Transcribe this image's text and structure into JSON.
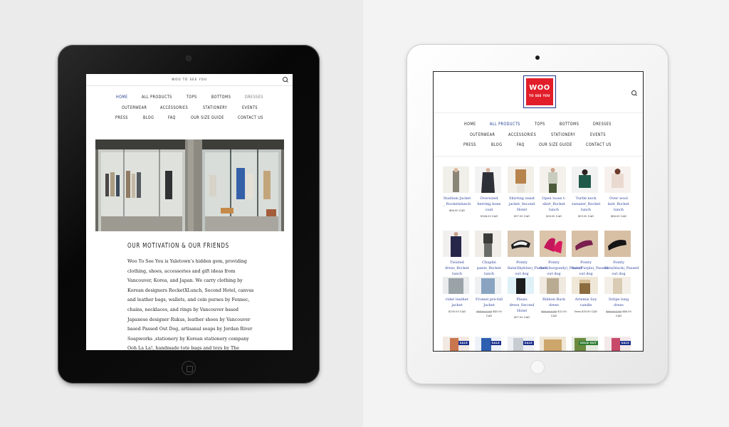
{
  "left_screen": {
    "brand": "WOO TO SEE YOU",
    "nav": [
      {
        "label": "HOME",
        "state": "active"
      },
      {
        "label": "ALL PRODUCTS",
        "state": ""
      },
      {
        "label": "TOPS",
        "state": ""
      },
      {
        "label": "BOTTOMS",
        "state": ""
      },
      {
        "label": "DRESSES",
        "state": "hover"
      },
      {
        "label": "OUTERWEAR",
        "state": ""
      },
      {
        "label": "ACCESSORIES",
        "state": ""
      },
      {
        "label": "STATIONERY",
        "state": ""
      },
      {
        "label": "EVENTS",
        "state": ""
      },
      {
        "label": "PRESS",
        "state": ""
      },
      {
        "label": "BLOG",
        "state": ""
      },
      {
        "label": "FAQ",
        "state": ""
      },
      {
        "label": "OUR SIZE GUIDE",
        "state": ""
      },
      {
        "label": "CONTACT US",
        "state": ""
      }
    ],
    "heading": "OUR MOTIVATION & OUR FRIENDS",
    "body_lines": [
      "Woo To See You is Yaletown’s hidden gem, providing",
      "clothing, shoes, accessories and gift ideas from",
      "Vancouver, Korea, and Japan. We carry clothing by",
      "Korean designers RocketXLunch, Second Hotel, canvas",
      "and leather bags, wallets, and coin purses by Fennec,",
      "chains, necklaces, and rings by Vancouver based",
      "Japanese designer Rukus, leather shoes by Vancouver",
      "based Passed Out Dog, artisanal soaps by Jordan River",
      "Soapworks ,stationery by Korean stationery company",
      "Ooh La La!, handmade tote bags and toys by The"
    ]
  },
  "right_screen": {
    "logo_main": "WOO",
    "logo_sub": "TO SEE YOU",
    "nav": [
      {
        "label": "HOME",
        "state": ""
      },
      {
        "label": "ALL PRODUCTS",
        "state": "active"
      },
      {
        "label": "TOPS",
        "state": ""
      },
      {
        "label": "BOTTOMS",
        "state": ""
      },
      {
        "label": "DRESSES",
        "state": ""
      },
      {
        "label": "OUTERWEAR",
        "state": ""
      },
      {
        "label": "ACCESSORIES",
        "state": ""
      },
      {
        "label": "STATIONERY",
        "state": ""
      },
      {
        "label": "EVENTS",
        "state": ""
      },
      {
        "label": "PRESS",
        "state": ""
      },
      {
        "label": "BLOG",
        "state": ""
      },
      {
        "label": "FAQ",
        "state": ""
      },
      {
        "label": "OUR SIZE GUIDE",
        "state": ""
      },
      {
        "label": "CONTACT US",
        "state": ""
      }
    ],
    "products": [
      {
        "name": "Stadium Jacket _ Rocketxlunch",
        "price": "$86.00 CAD",
        "old_price": "",
        "badge": ""
      },
      {
        "name": "Oversized herring bone coat",
        "price": "$166.00 CAD",
        "old_price": "",
        "badge": ""
      },
      {
        "name": "Shirring waist jacket_Second Hotel",
        "price": "$97.00 CAD",
        "old_price": "",
        "badge": ""
      },
      {
        "name": "Open loose t-shirt_Rocket lunch",
        "price": "$38.00 CAD",
        "old_price": "",
        "badge": ""
      },
      {
        "name": "Turtle neck sweater_Rocket lunch",
        "price": "$59.00 CAD",
        "old_price": "",
        "badge": ""
      },
      {
        "name": "Over wool knit_Rocket lunch",
        "price": "$86.00 CAD",
        "old_price": "",
        "badge": ""
      },
      {
        "name": "Twisted dress_Rocket lunch",
        "price": "",
        "old_price": "",
        "badge": ""
      },
      {
        "name": "Chaplin pants_Rocket lunch",
        "price": "",
        "old_price": "",
        "badge": ""
      },
      {
        "name": "Pointy flats(Skyblue)_Passed out dog",
        "price": "",
        "old_price": "",
        "badge": ""
      },
      {
        "name": "Pointy flats(burgundy)_Passed out dog",
        "price": "",
        "old_price": "",
        "badge": ""
      },
      {
        "name": "Pointy flats(Purple)_Passed out dog",
        "price": "",
        "old_price": "",
        "badge": ""
      },
      {
        "name": "Pointy flats(black)_Passed out dog",
        "price": "",
        "old_price": "",
        "badge": ""
      },
      {
        "name": "rider leather jacket",
        "price": "$150.00 CAD",
        "old_price": "",
        "badge": ""
      },
      {
        "name": "Fromel pre-fall Jacket",
        "price": "$45.00 CAD",
        "old_price": "$84.00 CAD",
        "badge": ""
      },
      {
        "name": "Pleats dress_Second Hotel",
        "price": "$97.00 CAD",
        "old_price": "",
        "badge": ""
      },
      {
        "name": "Ribbon Back dress",
        "price": "$32.00 CAD",
        "old_price": "$65.00 CAD",
        "badge": ""
      },
      {
        "name": "Artemis Soy candle",
        "price": "from $18.00 CAD",
        "old_price": "",
        "badge": ""
      },
      {
        "name": "Stripe long dress",
        "price": "$46.00 CAD",
        "old_price": "$66.00 CAD",
        "badge": ""
      },
      {
        "name": "",
        "price": "",
        "old_price": "",
        "badge": "SALE"
      },
      {
        "name": "",
        "price": "",
        "old_price": "",
        "badge": "SALE"
      },
      {
        "name": "",
        "price": "",
        "old_price": "",
        "badge": "SALE"
      },
      {
        "name": "",
        "price": "",
        "old_price": "",
        "badge": ""
      },
      {
        "name": "",
        "price": "",
        "old_price": "",
        "badge": "SOLD OUT"
      },
      {
        "name": "",
        "price": "",
        "old_price": "",
        "badge": "SALE"
      }
    ]
  },
  "colors": {
    "nav_active": "#1e3a8f",
    "product_link": "#2a3f9a",
    "logo_red": "#e21e2a",
    "logo_border": "#1d2f8c",
    "sale_badge": "#1d2f8c",
    "sold_out_badge": "#2e7d32"
  }
}
